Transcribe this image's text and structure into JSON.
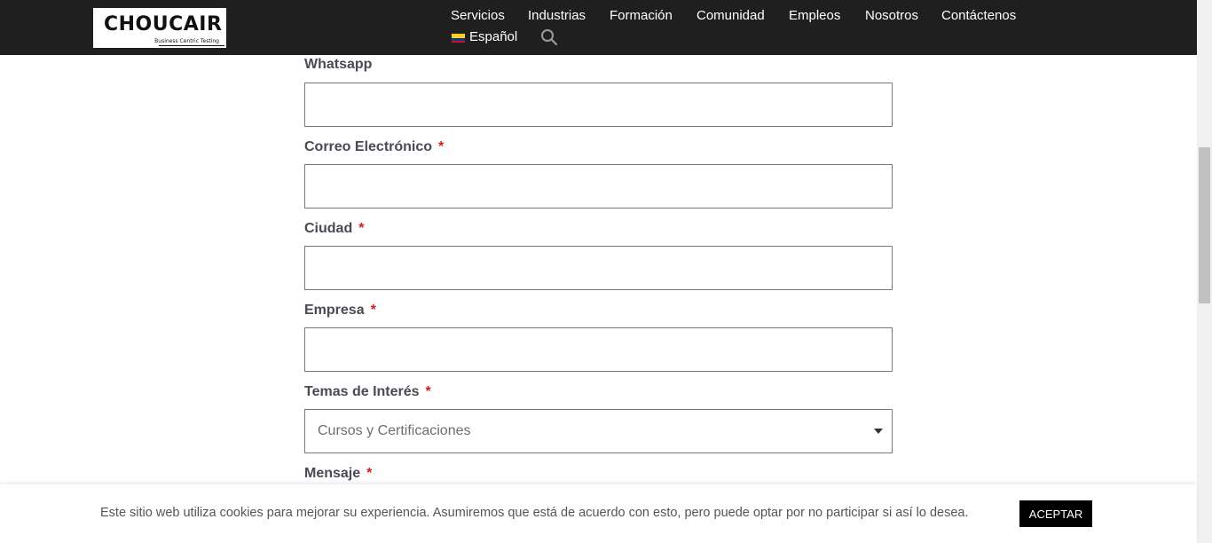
{
  "header": {
    "logo": {
      "wordmark": "CHOUCAIR",
      "tagline": "Business Centric Testing"
    },
    "nav": [
      {
        "label": "Servicios"
      },
      {
        "label": "Industrias"
      },
      {
        "label": "Formación"
      },
      {
        "label": "Comunidad"
      },
      {
        "label": "Empleos"
      },
      {
        "label": "Nosotros"
      },
      {
        "label": "Contáctenos"
      }
    ],
    "language": {
      "label": "Español",
      "flag_colors": [
        "#fcd116",
        "#003893",
        "#ce1126"
      ]
    },
    "search_icon": "search-icon"
  },
  "form": {
    "fields": [
      {
        "label": "Whatsapp",
        "required": false,
        "value": ""
      },
      {
        "label": "Correo Electrónico",
        "required": true,
        "value": ""
      },
      {
        "label": "Ciudad",
        "required": true,
        "value": ""
      },
      {
        "label": "Empresa",
        "required": true,
        "value": ""
      }
    ],
    "topics": {
      "label": "Temas de Interés",
      "required": true,
      "selected": "Cursos y Certificaciones"
    },
    "message": {
      "label": "Mensaje",
      "required": true
    },
    "required_marker": "*"
  },
  "cookie_bar": {
    "text": "Este sitio web utiliza cookies para mejorar su experiencia. Asumiremos que está de acuerdo con esto, pero puede optar por no participar si así lo desea.",
    "accept_label": "ACEPTAR"
  },
  "colors": {
    "header_bg": "#1f1f1f",
    "required": "#d21d1d",
    "label": "#4a4a55",
    "button_bg": "#000000"
  }
}
